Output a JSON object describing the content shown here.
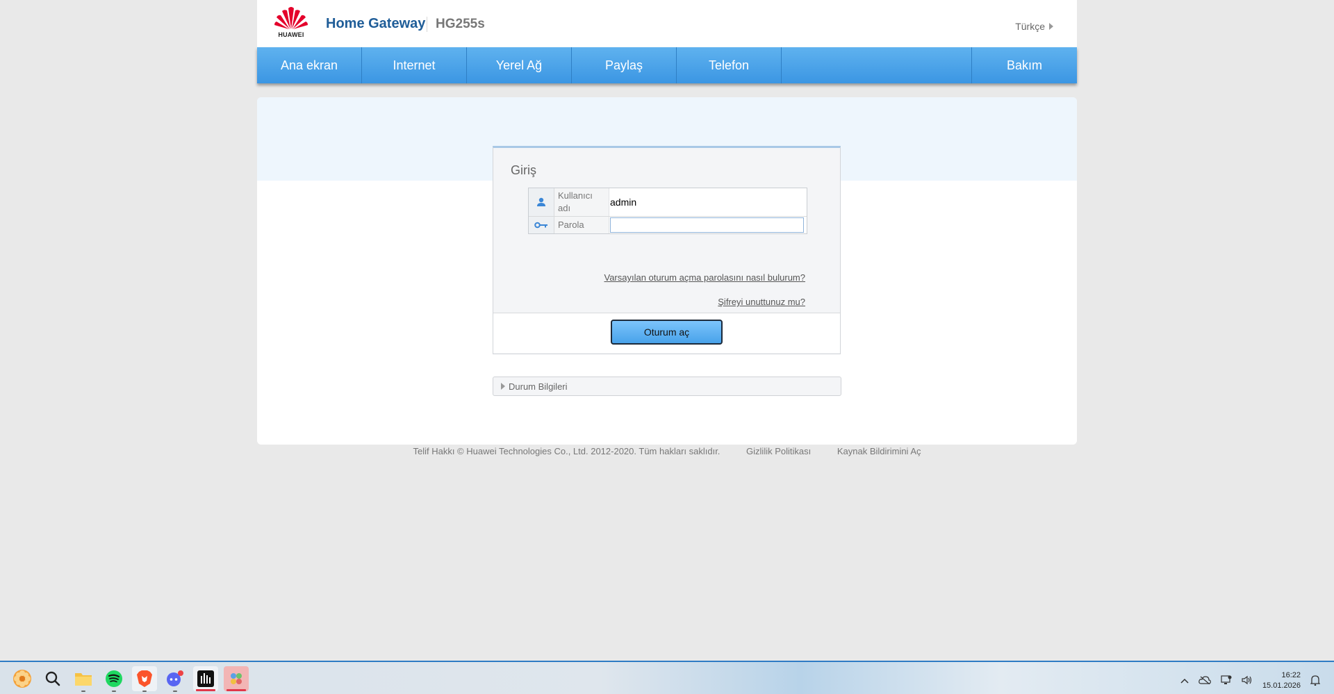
{
  "header": {
    "logo_text": "HUAWEI",
    "brand": "Home Gateway",
    "model": "HG255s",
    "language": "Türkçe"
  },
  "nav": {
    "items": [
      "Ana ekran",
      "Internet",
      "Yerel Ağ",
      "Paylaş",
      "Telefon"
    ],
    "right_item": "Bakım"
  },
  "login": {
    "title": "Giriş",
    "username_label": "Kullanıcı adı",
    "username_value": "admin",
    "password_label": "Parola",
    "password_value": "",
    "default_password_link": "Varsayılan oturum açma parolasını nasıl bulurum?",
    "forgot_password_link": "Şifreyi unuttunuz mu?",
    "submit_label": "Oturum aç"
  },
  "status": {
    "label": "Durum Bilgileri"
  },
  "footer": {
    "copyright": "Telif Hakkı © Huawei Technologies Co., Ltd. 2012-2020. Tüm hakları saklıdır.",
    "privacy": "Gizlilik Politikası",
    "source_notice": "Kaynak Bildirimini Aç"
  },
  "taskbar": {
    "time": "16:22",
    "date": "15.01.2026"
  },
  "colors": {
    "brand_blue": "#1f5d98",
    "nav_blue": "#3b96e3",
    "huawei_red": "#e4002b"
  }
}
